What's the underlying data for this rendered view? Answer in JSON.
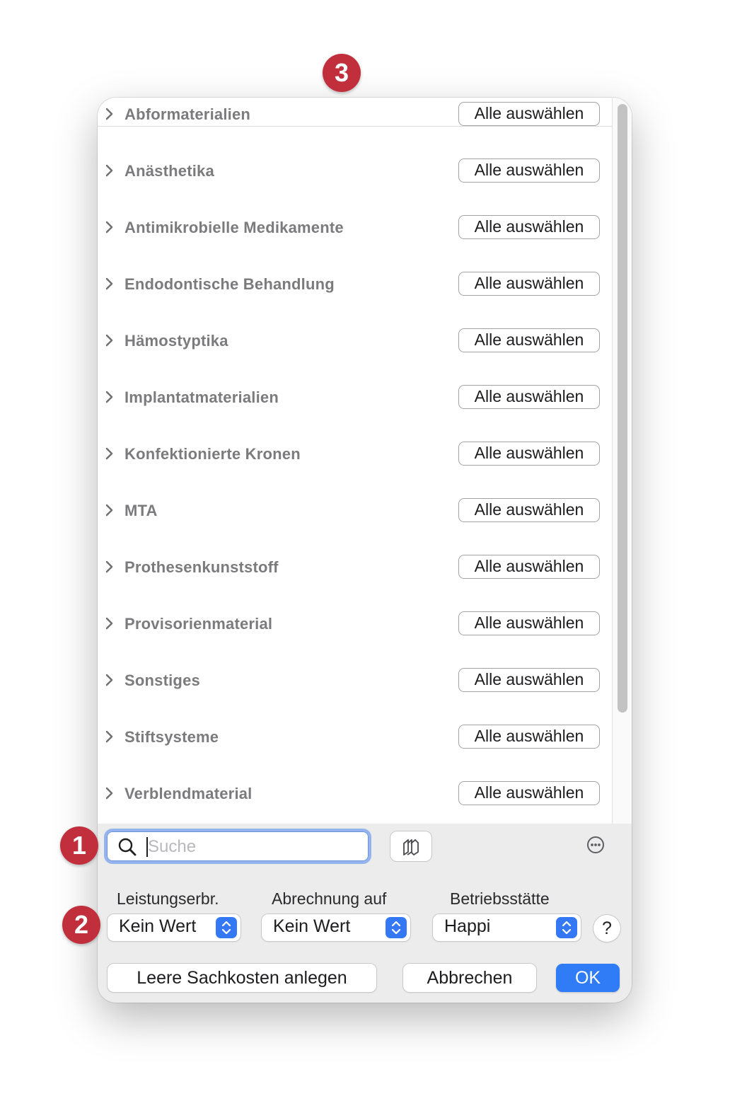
{
  "categories": [
    {
      "label": "Abformaterialien",
      "button": "Alle auswählen"
    },
    {
      "label": "Anästhetika",
      "button": "Alle auswählen"
    },
    {
      "label": "Antimikrobielle Medikamente",
      "button": "Alle auswählen"
    },
    {
      "label": "Endodontische Behandlung",
      "button": "Alle auswählen"
    },
    {
      "label": "Hämostyptika",
      "button": "Alle auswählen"
    },
    {
      "label": "Implantatmaterialien",
      "button": "Alle auswählen"
    },
    {
      "label": "Konfektionierte Kronen",
      "button": "Alle auswählen"
    },
    {
      "label": "MTA",
      "button": "Alle auswählen"
    },
    {
      "label": "Prothesenkunststoff",
      "button": "Alle auswählen"
    },
    {
      "label": "Provisorienmaterial",
      "button": "Alle auswählen"
    },
    {
      "label": "Sonstiges",
      "button": "Alle auswählen"
    },
    {
      "label": "Stiftsysteme",
      "button": "Alle auswählen"
    },
    {
      "label": "Verblendmaterial",
      "button": "Alle auswählen"
    }
  ],
  "search": {
    "placeholder": "Suche",
    "value": ""
  },
  "filters": {
    "leistungserbringer": {
      "label": "Leistungserbr.",
      "value": "Kein Wert"
    },
    "abrechnung": {
      "label": "Abrechnung auf",
      "value": "Kein Wert"
    },
    "betriebsstaette": {
      "label": "Betriebsstätte",
      "value": "Happi"
    }
  },
  "help_label": "?",
  "buttons": {
    "create_empty": "Leere Sachkosten anlegen",
    "cancel": "Abbrechen",
    "ok": "OK"
  },
  "badges": {
    "one": "1",
    "two": "2",
    "three": "3"
  },
  "colors": {
    "accent": "#2f7cf6",
    "stepper": "#3478f6",
    "badge": "#c12f3c",
    "focus_ring": "#93b4ec",
    "category_text": "#7b7b7d"
  },
  "icons": {
    "disclosure": "chevron-right-icon",
    "search": "magnifier-icon",
    "stack": "stacked-layers-icon",
    "more": "ellipsis-circle-icon",
    "stepper": "up-down-chevron-icon"
  }
}
